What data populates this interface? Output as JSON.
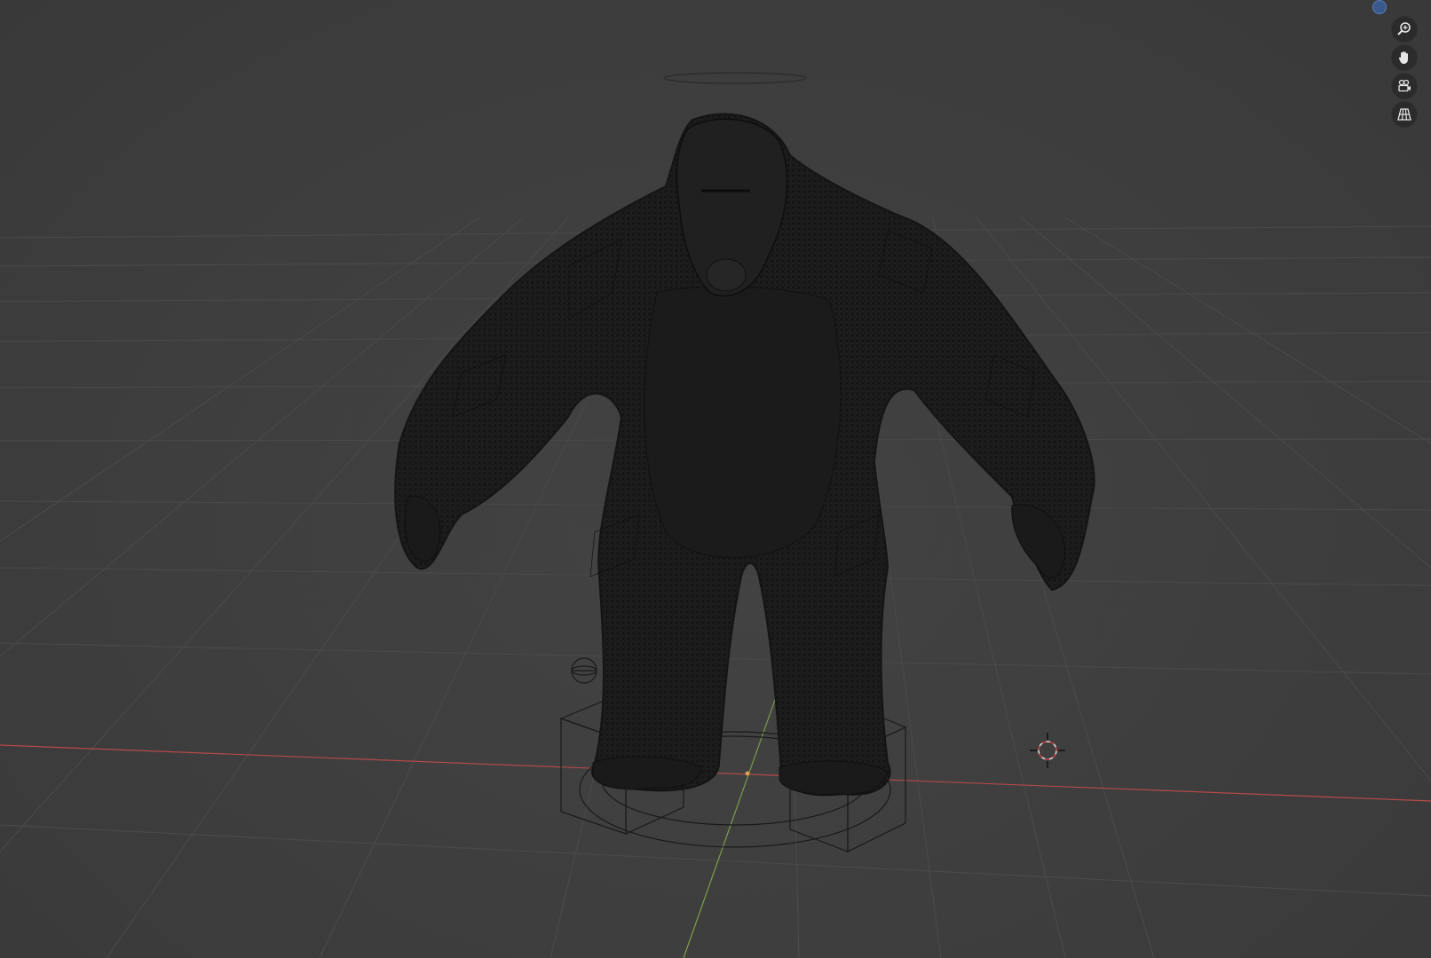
{
  "viewport": {
    "background": "#3d3d3d",
    "grid_color": "#4a4a4a",
    "x_axis_color": "#b84a4a",
    "y_axis_color": "#7fa34a",
    "mesh_color": "#1e1e1e",
    "wire_color": "#0f0f0f"
  },
  "nav_controls": {
    "gizmo": "navigation-gizmo-dot",
    "buttons": [
      {
        "icon": "zoom-icon"
      },
      {
        "icon": "pan-hand-icon"
      },
      {
        "icon": "camera-view-icon"
      },
      {
        "icon": "ortho-grid-icon"
      }
    ]
  },
  "scene_objects": {
    "character": "gorilla-mesh",
    "rig_controls": [
      "halo-head-control",
      "root-circle-control",
      "foot-cube-left",
      "foot-cube-right",
      "hand-sphere-control"
    ],
    "cursor": "3d-cursor"
  }
}
